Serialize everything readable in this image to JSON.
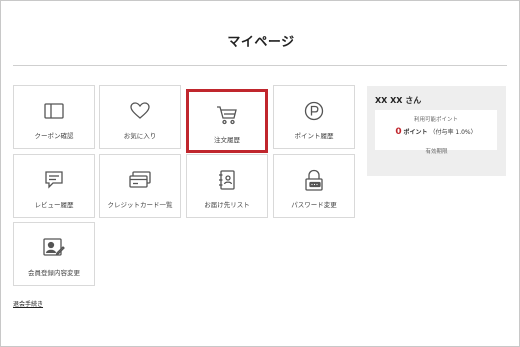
{
  "page": {
    "title": "マイページ"
  },
  "tiles": [
    {
      "label": "クーポン確認",
      "icon": "coupon-icon"
    },
    {
      "label": "お気に入り",
      "icon": "heart-icon"
    },
    {
      "label": "注文履歴",
      "icon": "cart-icon",
      "selected": true
    },
    {
      "label": "ポイント履歴",
      "icon": "point-icon"
    },
    {
      "label": "レビュー履歴",
      "icon": "chat-icon"
    },
    {
      "label": "クレジットカード一覧",
      "icon": "credit-card-icon"
    },
    {
      "label": "お届け先リスト",
      "icon": "address-book-icon"
    },
    {
      "label": "パスワード変更",
      "icon": "lock-icon"
    },
    {
      "label": "会員登録内容変更",
      "icon": "profile-edit-icon"
    }
  ],
  "member": {
    "name": "XX XX さん",
    "points_label": "利用可能ポイント",
    "points_value": "0",
    "points_unit": "ポイント",
    "grant_rate": "（付与率 1.0%）",
    "expiry_label": "有効期限"
  },
  "footer": {
    "withdraw_link": "退会手続き"
  },
  "colors": {
    "accent": "#c0262d",
    "panel": "#eeeeee",
    "border": "#d9d9d9"
  }
}
